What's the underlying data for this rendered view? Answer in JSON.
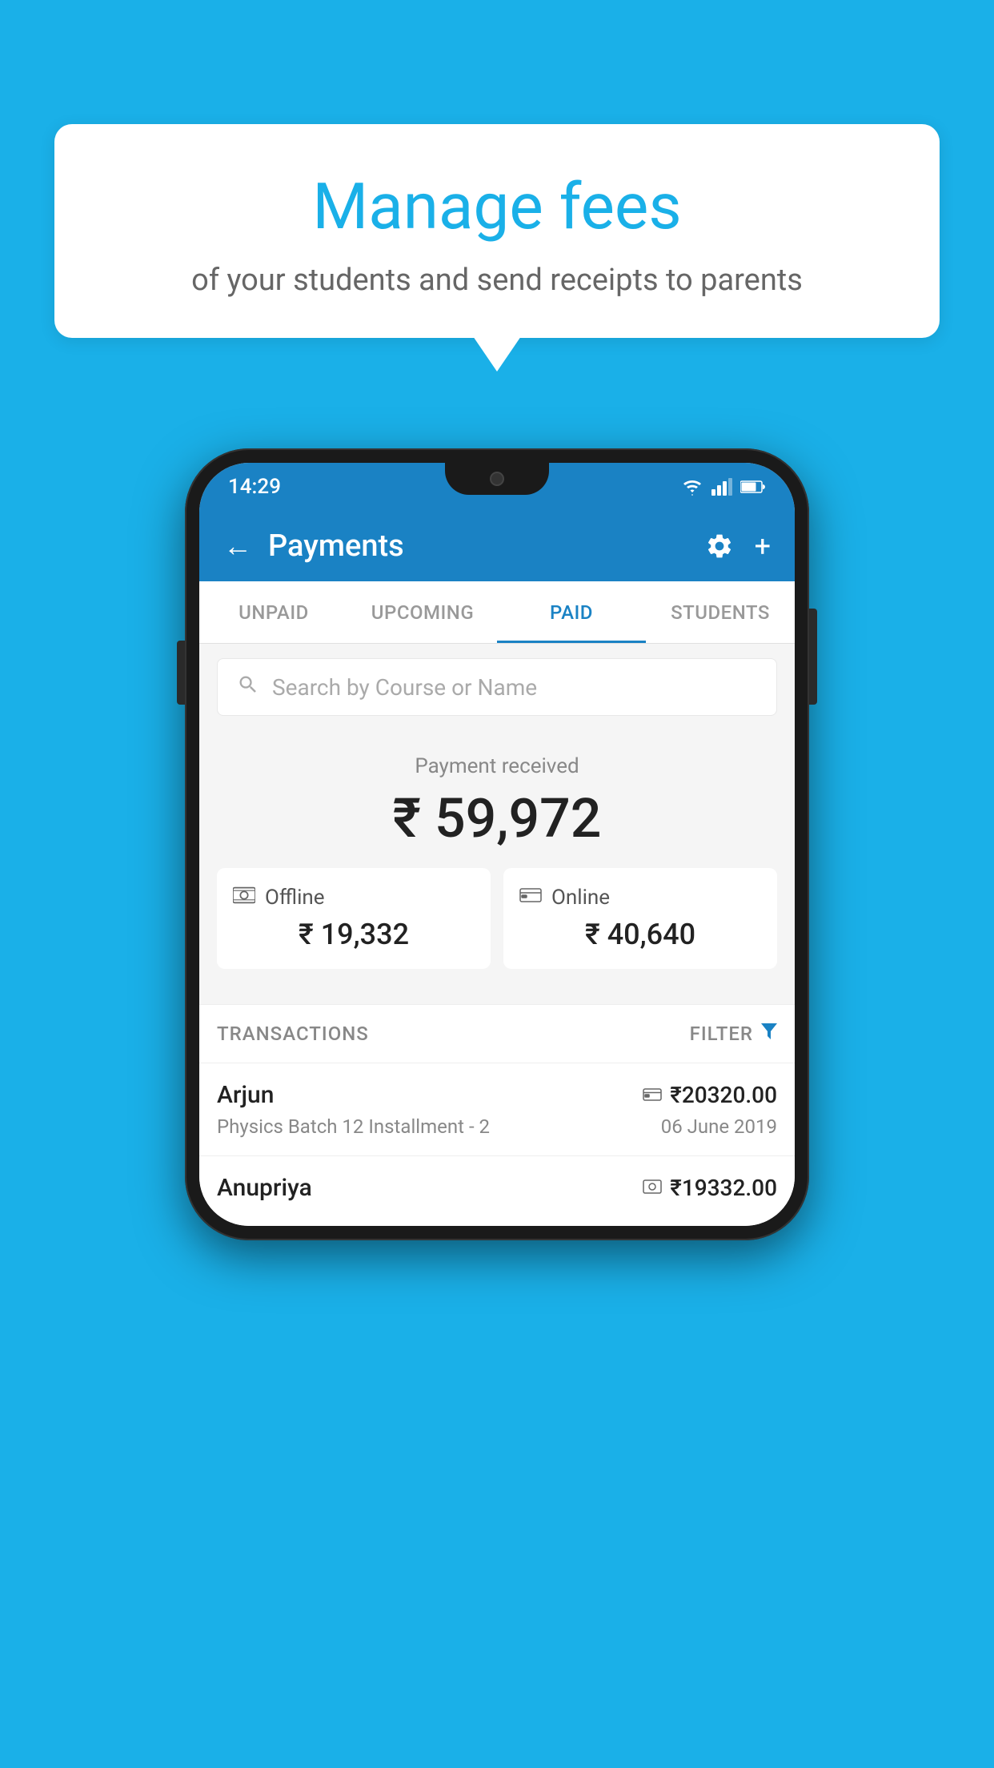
{
  "background_color": "#1ab0e8",
  "bubble": {
    "title": "Manage fees",
    "subtitle": "of your students and send receipts to parents"
  },
  "status_bar": {
    "time": "14:29",
    "wifi_icon": "wifi",
    "signal_icon": "signal",
    "battery_icon": "battery"
  },
  "app_bar": {
    "title": "Payments",
    "back_icon": "←",
    "settings_icon": "⚙",
    "add_icon": "+"
  },
  "tabs": [
    {
      "label": "UNPAID",
      "active": false
    },
    {
      "label": "UPCOMING",
      "active": false
    },
    {
      "label": "PAID",
      "active": true
    },
    {
      "label": "STUDENTS",
      "active": false
    }
  ],
  "search": {
    "placeholder": "Search by Course or Name"
  },
  "payment_summary": {
    "label": "Payment received",
    "amount": "₹ 59,972",
    "offline_label": "Offline",
    "offline_amount": "₹ 19,332",
    "online_label": "Online",
    "online_amount": "₹ 40,640"
  },
  "transactions": {
    "section_label": "TRANSACTIONS",
    "filter_label": "FILTER",
    "rows": [
      {
        "name": "Arjun",
        "course": "Physics Batch 12 Installment - 2",
        "amount": "₹20320.00",
        "date": "06 June 2019",
        "payment_type": "online"
      },
      {
        "name": "Anupriya",
        "course": "",
        "amount": "₹19332.00",
        "date": "",
        "payment_type": "offline"
      }
    ]
  }
}
